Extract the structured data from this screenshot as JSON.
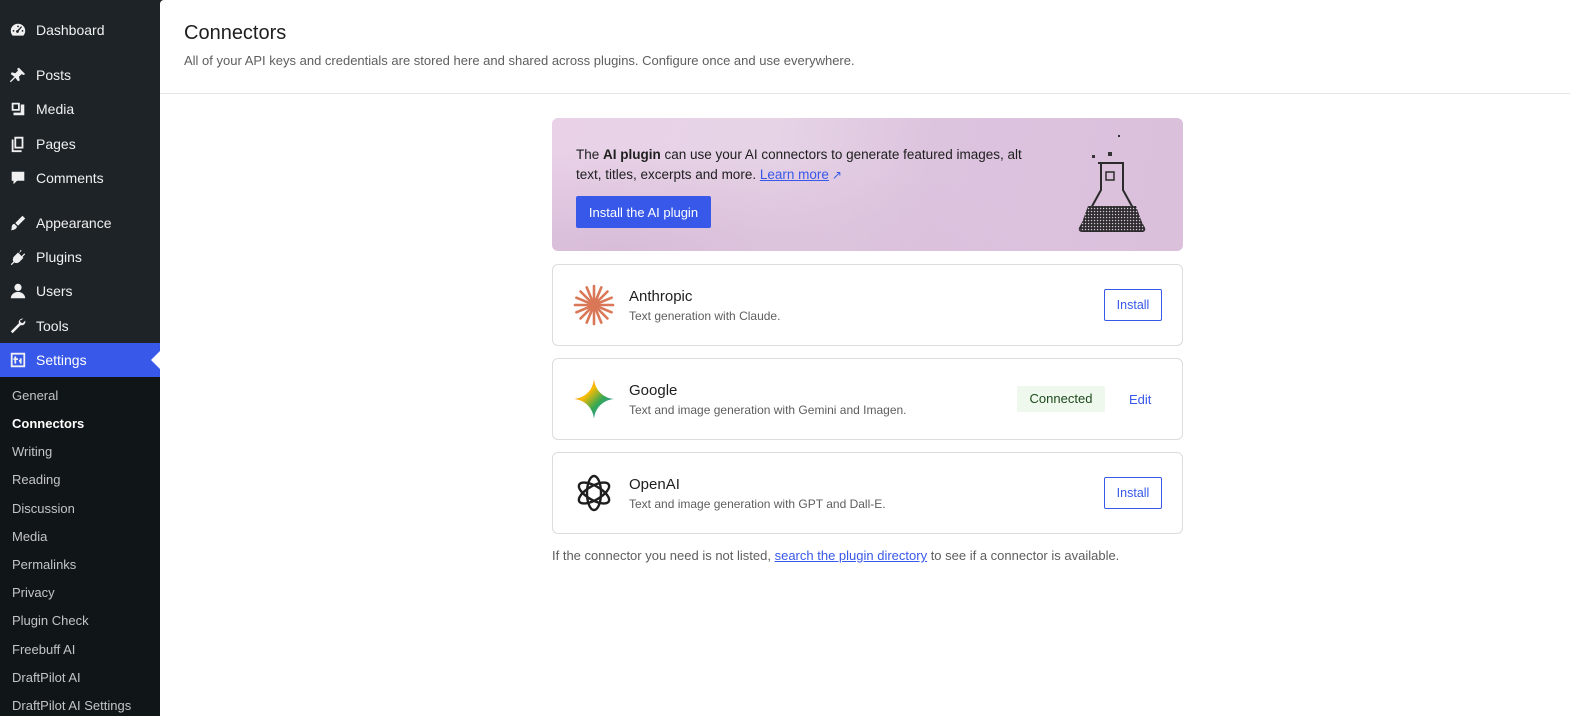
{
  "sidebar": {
    "items": [
      {
        "label": "Dashboard",
        "icon": "dashboard-icon"
      },
      {
        "label": "Posts",
        "icon": "pin-icon"
      },
      {
        "label": "Media",
        "icon": "media-icon"
      },
      {
        "label": "Pages",
        "icon": "pages-icon"
      },
      {
        "label": "Comments",
        "icon": "comment-icon"
      },
      {
        "label": "Appearance",
        "icon": "brush-icon"
      },
      {
        "label": "Plugins",
        "icon": "plug-icon"
      },
      {
        "label": "Users",
        "icon": "user-icon"
      },
      {
        "label": "Tools",
        "icon": "wrench-icon"
      },
      {
        "label": "Settings",
        "icon": "settings-icon",
        "active": true
      }
    ],
    "submenu": [
      {
        "label": "General"
      },
      {
        "label": "Connectors",
        "current": true
      },
      {
        "label": "Writing"
      },
      {
        "label": "Reading"
      },
      {
        "label": "Discussion"
      },
      {
        "label": "Media"
      },
      {
        "label": "Permalinks"
      },
      {
        "label": "Privacy"
      },
      {
        "label": "Plugin Check"
      },
      {
        "label": "Freebuff AI"
      },
      {
        "label": "DraftPilot AI"
      },
      {
        "label": "DraftPilot AI Settings"
      }
    ]
  },
  "header": {
    "title": "Connectors",
    "description": "All of your API keys and credentials are stored here and shared across plugins. Configure once and use everywhere."
  },
  "banner": {
    "text_before": "The ",
    "text_bold": "AI plugin",
    "text_after": " can use your AI connectors to generate featured images, alt text, titles, excerpts and more. ",
    "learn_more": "Learn more",
    "external_glyph": "↗",
    "button_label": "Install the AI plugin"
  },
  "connectors": [
    {
      "name": "Anthropic",
      "description": "Text generation with Claude.",
      "action": "Install",
      "icon": "anthropic-logo-icon"
    },
    {
      "name": "Google",
      "description": "Text and image generation with Gemini and Imagen.",
      "status": "Connected",
      "action": "Edit",
      "icon": "google-gemini-logo-icon"
    },
    {
      "name": "OpenAI",
      "description": "Text and image generation with GPT and Dall-E.",
      "action": "Install",
      "icon": "openai-logo-icon"
    }
  ],
  "footer": {
    "before": "If the connector you need is not listed, ",
    "link": "search the plugin directory",
    "after": " to see if a connector is available."
  },
  "colors": {
    "accent": "#3858e9",
    "sidebar_bg": "#1d2327",
    "submenu_bg": "#101517",
    "connected_bg": "#eff8ec",
    "anthropic": "#d97757"
  }
}
